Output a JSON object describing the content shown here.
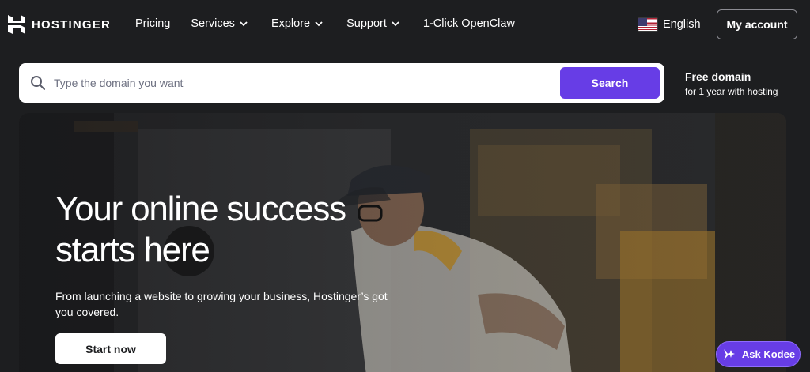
{
  "header": {
    "brand": "HOSTINGER",
    "nav": [
      {
        "label": "Pricing",
        "dropdown": false
      },
      {
        "label": "Services",
        "dropdown": true
      },
      {
        "label": "Explore",
        "dropdown": true
      },
      {
        "label": "Support",
        "dropdown": true
      },
      {
        "label": "1-Click OpenClaw",
        "dropdown": false
      }
    ],
    "language": "English",
    "account_label": "My account"
  },
  "search": {
    "placeholder": "Type the domain you want",
    "value": "",
    "button_label": "Search"
  },
  "promo": {
    "title": "Free domain",
    "subtitle_prefix": "for 1 year with",
    "link_label": "hosting"
  },
  "hero": {
    "title": "Your online success starts here",
    "subtitle": "From launching a website to growing your business, Hostinger’s got you covered.",
    "cta_label": "Start now"
  },
  "assistant": {
    "label": "Ask Kodee"
  },
  "colors": {
    "background": "#1d1e20",
    "accent": "#673de6",
    "text": "#ffffff"
  }
}
